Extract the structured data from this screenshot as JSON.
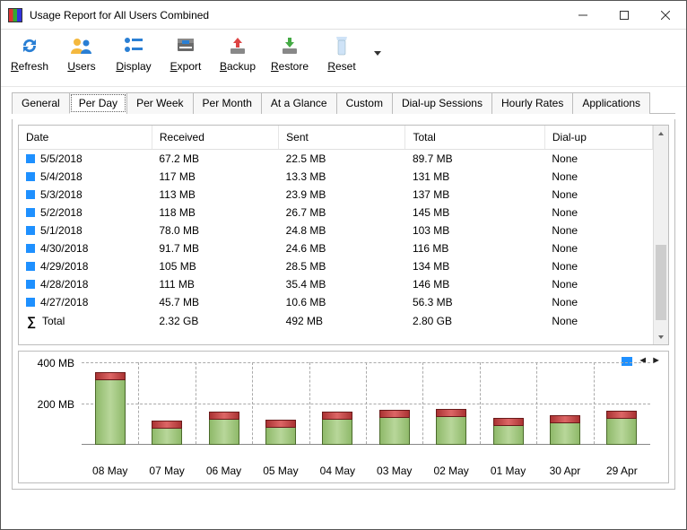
{
  "window": {
    "title": "Usage Report for All Users Combined"
  },
  "toolbar": [
    {
      "id": "refresh",
      "label": "Refresh"
    },
    {
      "id": "users",
      "label": "Users"
    },
    {
      "id": "display",
      "label": "Display"
    },
    {
      "id": "export",
      "label": "Export"
    },
    {
      "id": "backup",
      "label": "Backup"
    },
    {
      "id": "restore",
      "label": "Restore"
    },
    {
      "id": "reset",
      "label": "Reset"
    }
  ],
  "tabs": [
    "General",
    "Per Day",
    "Per Week",
    "Per Month",
    "At a Glance",
    "Custom",
    "Dial-up Sessions",
    "Hourly Rates",
    "Applications"
  ],
  "active_tab": "Per Day",
  "table": {
    "headers": [
      "Date",
      "Received",
      "Sent",
      "Total",
      "Dial-up"
    ],
    "rows": [
      {
        "date": "5/5/2018",
        "received": "67.2 MB",
        "sent": "22.5 MB",
        "total": "89.7 MB",
        "dialup": "None"
      },
      {
        "date": "5/4/2018",
        "received": "117 MB",
        "sent": "13.3 MB",
        "total": "131 MB",
        "dialup": "None"
      },
      {
        "date": "5/3/2018",
        "received": "113 MB",
        "sent": "23.9 MB",
        "total": "137 MB",
        "dialup": "None"
      },
      {
        "date": "5/2/2018",
        "received": "118 MB",
        "sent": "26.7 MB",
        "total": "145 MB",
        "dialup": "None"
      },
      {
        "date": "5/1/2018",
        "received": "78.0 MB",
        "sent": "24.8 MB",
        "total": "103 MB",
        "dialup": "None"
      },
      {
        "date": "4/30/2018",
        "received": "91.7 MB",
        "sent": "24.6 MB",
        "total": "116 MB",
        "dialup": "None"
      },
      {
        "date": "4/29/2018",
        "received": "105 MB",
        "sent": "28.5 MB",
        "total": "134 MB",
        "dialup": "None"
      },
      {
        "date": "4/28/2018",
        "received": "111 MB",
        "sent": "35.4 MB",
        "total": "146 MB",
        "dialup": "None"
      },
      {
        "date": "4/27/2018",
        "received": "45.7 MB",
        "sent": "10.6 MB",
        "total": "56.3 MB",
        "dialup": "None"
      }
    ],
    "total_row": {
      "label": "Total",
      "received": "2.32 GB",
      "sent": "492 MB",
      "total": "2.80 GB",
      "dialup": "None"
    }
  },
  "chart_data": {
    "type": "bar",
    "title": "",
    "ylabel": "",
    "ylim": [
      0,
      400
    ],
    "yticks": [
      200,
      400
    ],
    "ytick_labels": [
      "200 MB",
      "400 MB"
    ],
    "categories": [
      "08 May",
      "07 May",
      "06 May",
      "05 May",
      "04 May",
      "03 May",
      "02 May",
      "01 May",
      "30 Apr",
      "29 Apr"
    ],
    "values": [
      320,
      85,
      130,
      90,
      130,
      140,
      145,
      100,
      115,
      135
    ]
  }
}
